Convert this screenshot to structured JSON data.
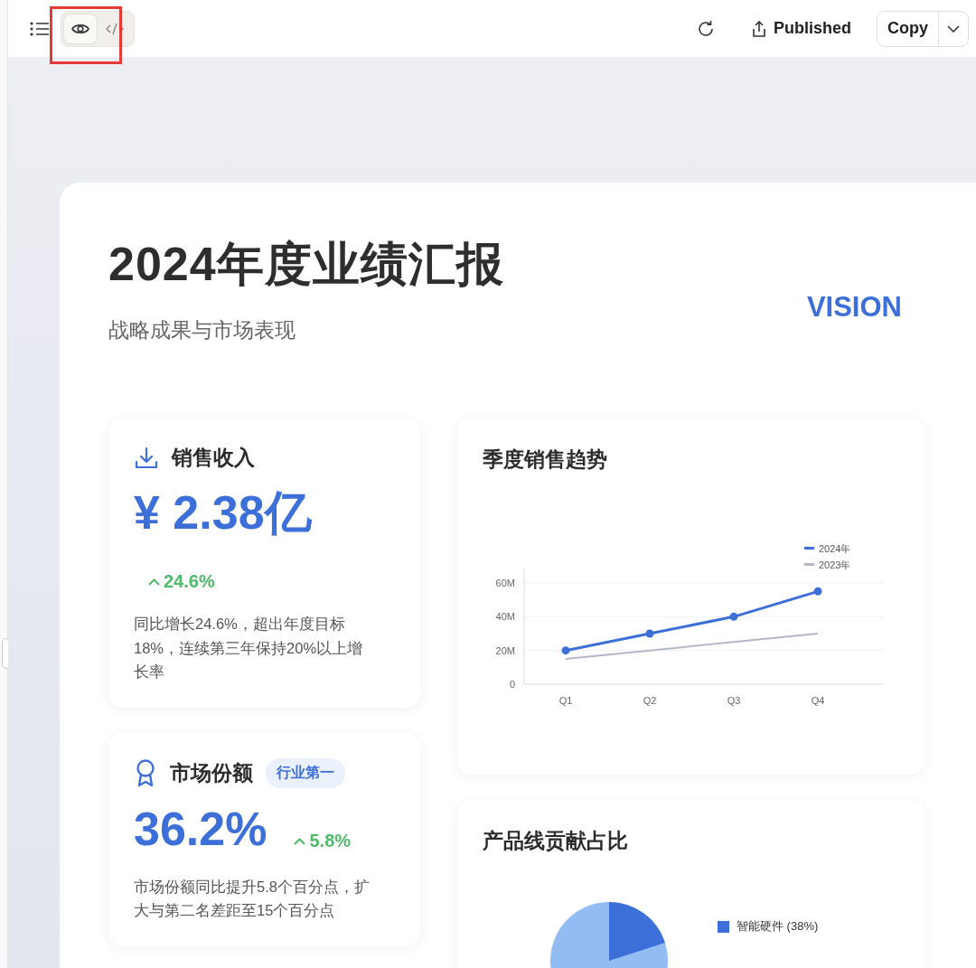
{
  "toolbar": {
    "view_modes": [
      {
        "kind": "preview",
        "selected": true
      },
      {
        "kind": "code",
        "selected": false
      }
    ],
    "publish": "Published",
    "copy": "Copy"
  },
  "report": {
    "title": "2024年度业绩汇报",
    "subtitle": "战略成果与市场表现",
    "brand": "VISION"
  },
  "metrics": [
    {
      "kind": "revenue",
      "title": "销售收入",
      "value": "¥ 2.38亿",
      "change": "24.6%",
      "note": "同比增长24.6%，超出年度目标18%，连续第三年保持20%以上增长率"
    },
    {
      "kind": "share",
      "title": "市场份额",
      "badge": "行业第一",
      "value": "36.2%",
      "change": "5.8%",
      "note": "市场份额同比提升5.8个百分点，扩大与第二名差距至15个百分点"
    }
  ],
  "trend_card": {
    "title": "季度销售趋势",
    "chart_data": {
      "type": "line",
      "legend": true,
      "categories": [
        "Q1",
        "Q2",
        "Q3",
        "Q4"
      ],
      "series": [
        {
          "name": "2024年",
          "color": "#3d6fd8",
          "marker": "circle",
          "values": [
            20,
            30,
            40,
            55
          ]
        },
        {
          "name": "2023年",
          "color": "#b3b8c8",
          "values": [
            15,
            20,
            25,
            30
          ]
        }
      ],
      "ylim": [
        0,
        60
      ],
      "yticks": [
        {
          "value": 0,
          "label": "0"
        },
        {
          "value": 20,
          "label": "20M"
        },
        {
          "value": 40,
          "label": "40M"
        },
        {
          "value": 60,
          "label": "60M"
        }
      ]
    }
  },
  "share_card": {
    "title": "产品线贡献占比",
    "legend": [
      {
        "label": "智能硬件 (38%)",
        "color": "#3d6fd8"
      }
    ]
  }
}
